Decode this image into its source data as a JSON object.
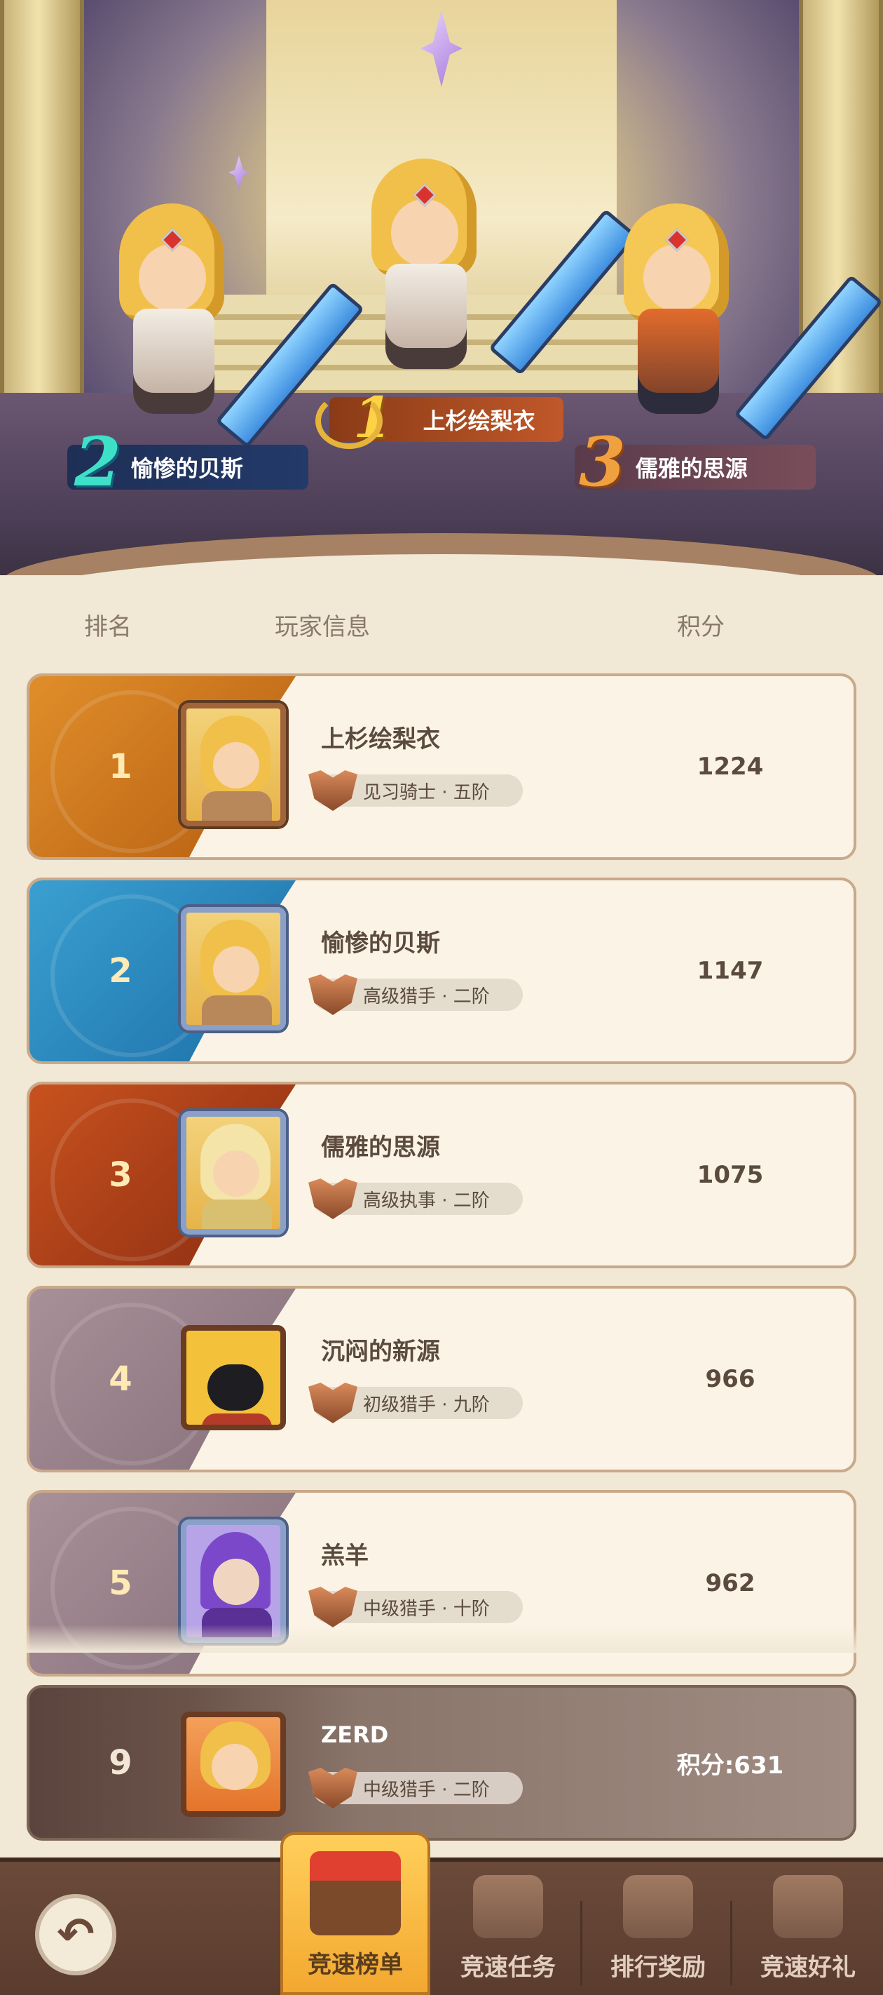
{
  "podium": {
    "first": {
      "rank": "1",
      "name": "上杉绘梨衣"
    },
    "second": {
      "rank": "2",
      "name": "愉惨的贝斯"
    },
    "third": {
      "rank": "3",
      "name": "儒雅的思源"
    }
  },
  "table_header": {
    "rank": "排名",
    "player": "玩家信息",
    "score": "积分"
  },
  "rows": [
    {
      "rank": "1",
      "name": "上杉绘梨衣",
      "title": "见习骑士 · 五阶",
      "score": "1224",
      "color": "#e08e2a"
    },
    {
      "rank": "2",
      "name": "愉惨的贝斯",
      "title": "高级猎手 · 二阶",
      "score": "1147",
      "color": "#3aa0d0"
    },
    {
      "rank": "3",
      "name": "儒雅的思源",
      "title": "高级执事 · 二阶",
      "score": "1075",
      "color": "#c8521e"
    },
    {
      "rank": "4",
      "name": "沉闷的新源",
      "title": "初级猎手 · 九阶",
      "score": "966",
      "color": "#a89098"
    },
    {
      "rank": "5",
      "name": "羔羊",
      "title": "中级猎手 · 十阶",
      "score": "962",
      "color": "#a89098"
    }
  ],
  "me": {
    "rank": "9",
    "name": "ZERD",
    "title": "中级猎手 · 二阶",
    "score": "积分:631"
  },
  "nav": {
    "back_icon": "back-arrow-icon",
    "tabs": [
      {
        "label": "竞速榜单",
        "icon": "shop-stall-icon",
        "active": true
      },
      {
        "label": "竞速任务",
        "icon": "basket-icon",
        "active": false
      },
      {
        "label": "排行奖励",
        "icon": "gift-box-icon",
        "active": false
      },
      {
        "label": "竞速好礼",
        "icon": "treasure-bag-icon",
        "active": false
      }
    ]
  },
  "colors": {
    "accent": "#f3a830",
    "background": "#f1e8d6",
    "text": "#5b4a3e"
  }
}
